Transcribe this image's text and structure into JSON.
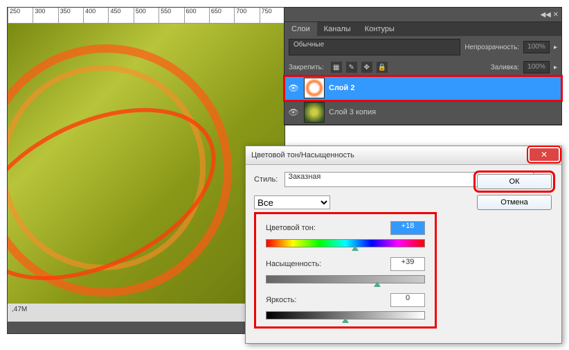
{
  "ruler": [
    "250",
    "300",
    "350",
    "400",
    "450",
    "500",
    "550",
    "600",
    "650",
    "700",
    "750"
  ],
  "status": ",47M",
  "panel": {
    "tabs": [
      "Слои",
      "Каналы",
      "Контуры"
    ],
    "blend_mode": "Обычные",
    "opacity_label": "Непрозрачность:",
    "opacity_val": "100%",
    "lock_label": "Закрепить:",
    "fill_label": "Заливка:",
    "fill_val": "100%",
    "layers": [
      {
        "name": "Слой 2",
        "selected": true
      },
      {
        "name": "Слой 3 копия",
        "selected": false
      }
    ]
  },
  "dialog": {
    "title": "Цветовой тон/Насыщенность",
    "style_label": "Стиль:",
    "style_value": "Заказная",
    "ok": "ОК",
    "cancel": "Отмена",
    "channel": "Все",
    "sliders": {
      "hue_label": "Цветовой тон:",
      "hue_val": "+18",
      "sat_label": "Насыщенность:",
      "sat_val": "+39",
      "light_label": "Яркость:",
      "light_val": "0"
    }
  }
}
